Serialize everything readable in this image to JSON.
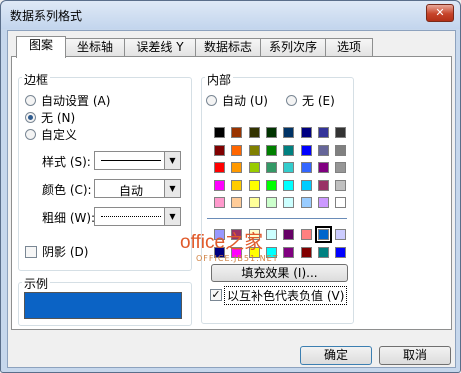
{
  "window": {
    "title": "数据系列格式",
    "close_glyph": "✕"
  },
  "tabs": [
    {
      "label": "图案",
      "active": true
    },
    {
      "label": "坐标轴"
    },
    {
      "label": "误差线 Y"
    },
    {
      "label": "数据标志"
    },
    {
      "label": "系列次序"
    },
    {
      "label": "选项"
    }
  ],
  "border": {
    "group_label": "边框",
    "options": [
      {
        "label": "自动设置 (A)",
        "selected": false
      },
      {
        "label": "无 (N)",
        "selected": true
      },
      {
        "label": "自定义",
        "selected": false
      }
    ],
    "style_label": "样式 (S):",
    "color_label": "颜色 (C):",
    "color_value": "自动",
    "weight_label": "粗细 (W):",
    "shadow_label": "阴影 (D)",
    "shadow_checked": false
  },
  "sample": {
    "label": "示例",
    "color": "#0b63c5"
  },
  "area": {
    "group_label": "内部",
    "auto_label": "自动 (U)",
    "none_label": "无 (E)",
    "palette_rows": [
      [
        "#000000",
        "#993300",
        "#333300",
        "#003300",
        "#003366",
        "#000080",
        "#333399",
        "#333333"
      ],
      [
        "#800000",
        "#ff6600",
        "#808000",
        "#008000",
        "#008080",
        "#0000ff",
        "#666699",
        "#808080"
      ],
      [
        "#ff0000",
        "#ff9900",
        "#99cc00",
        "#339966",
        "#33cccc",
        "#3366ff",
        "#800080",
        "#969696"
      ],
      [
        "#ff00ff",
        "#ffcc00",
        "#ffff00",
        "#00ff00",
        "#00ffff",
        "#00ccff",
        "#993366",
        "#c0c0c0"
      ],
      [
        "#ff99cc",
        "#ffcc99",
        "#ffff99",
        "#ccffcc",
        "#ccffff",
        "#99ccff",
        "#cc99ff",
        "#ffffff"
      ]
    ],
    "chart_rows": [
      [
        "#9999ff",
        "#993366",
        "#ffffcc",
        "#ccffff",
        "#660066",
        "#ff8080",
        "#0066cc",
        "#ccccff"
      ],
      [
        "#000080",
        "#ff00ff",
        "#ffff00",
        "#00ffff",
        "#800080",
        "#800000",
        "#008080",
        "#0000ff"
      ]
    ],
    "fill_effects_label": "填充效果 (I)...",
    "invert_label": "以互补色代表负值 (V)",
    "invert_checked": true
  },
  "buttons": {
    "ok": "确定",
    "cancel": "取消"
  },
  "watermark": {
    "brand": "office",
    "brand_suffix": "之家",
    "url": "OFFICE.JB51.NET"
  }
}
